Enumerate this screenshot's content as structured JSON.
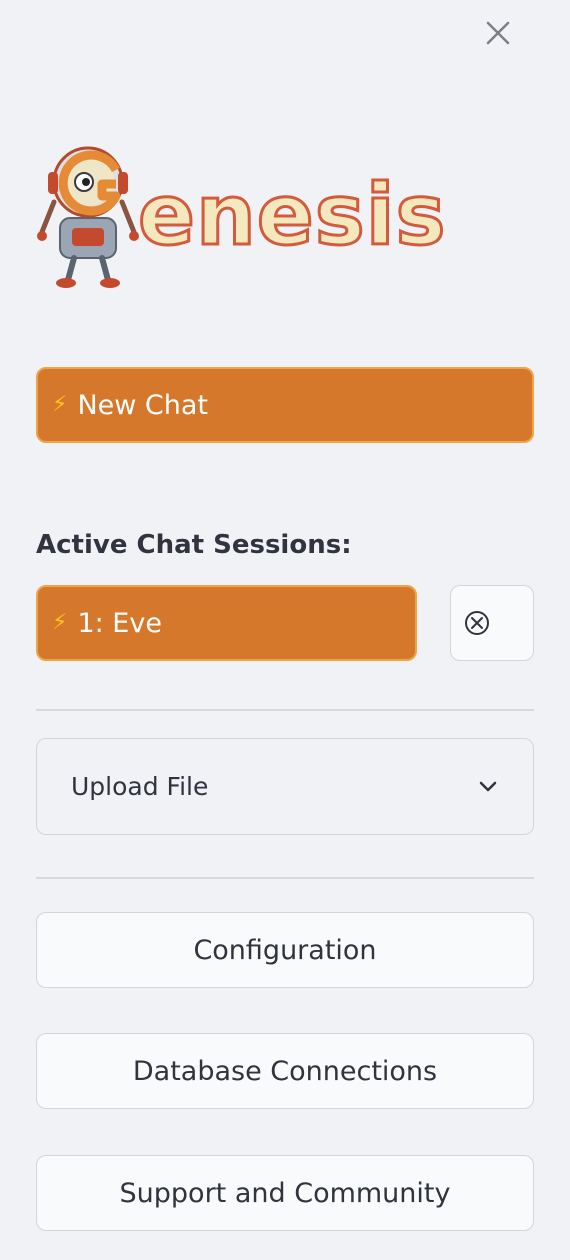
{
  "sidebar": {
    "close_icon": "close-icon",
    "logo_text": "Genesis",
    "new_chat_label": "New Chat",
    "sessions_heading": "Active Chat Sessions:",
    "sessions": [
      {
        "label": "1: Eve"
      }
    ],
    "session_close_icon": "circle-x-icon",
    "upload_label": "Upload File",
    "upload_icon": "chevron-down-icon",
    "buttons": {
      "configuration": "Configuration",
      "database": "Database Connections",
      "support": "Support and Community"
    },
    "colors": {
      "accent": "#d6782b",
      "accent_border": "#eda547",
      "background": "#f0f2f6",
      "text": "#31333f"
    }
  }
}
